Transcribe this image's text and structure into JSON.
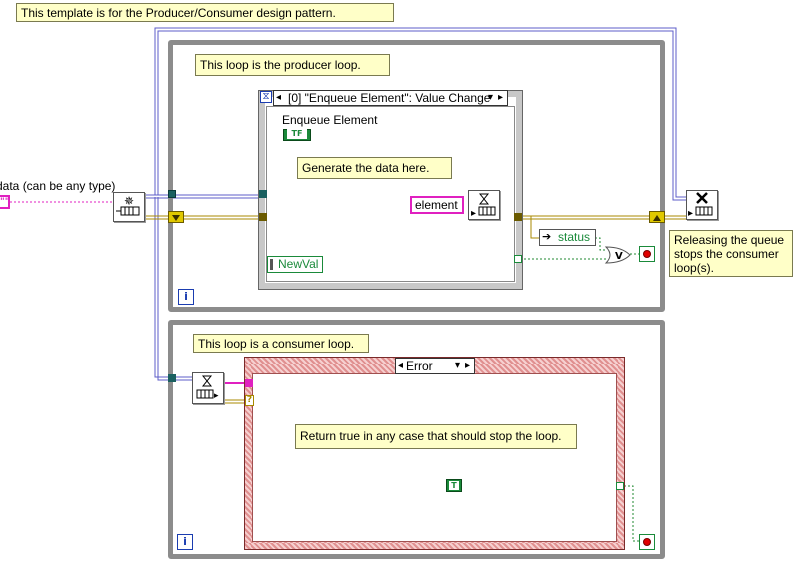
{
  "notes": {
    "template": "This template is for the Producer/Consumer design pattern.",
    "producer": "This loop is the producer loop.",
    "generate": "Generate the data here.",
    "release_line1": "Releasing the queue",
    "release_line2": "stops the consumer",
    "release_line3": "loop(s).",
    "consumer": "This loop is a consumer loop.",
    "return_true": "Return true in any case that should stop the loop."
  },
  "controls": {
    "data_label": "data (can be any type)",
    "data_value": "\"\"",
    "event_case": "[0] \"Enqueue Element\": Value Change",
    "enqueue_label": "Enqueue Element",
    "enqueue_bool": "TF",
    "new_val": "NewVal",
    "element": "element",
    "status": "status",
    "case_selector": "Error",
    "true_const": "T",
    "question_terminal": "?",
    "iteration": "i"
  },
  "colors": {
    "pink_wire": "#e020c0",
    "error_wire": "#c8a800",
    "queue_wire": "#6060c0",
    "bool_wire": "#208a30",
    "loop_border": "#8c8c8c",
    "case_stripe": "#d07070"
  }
}
